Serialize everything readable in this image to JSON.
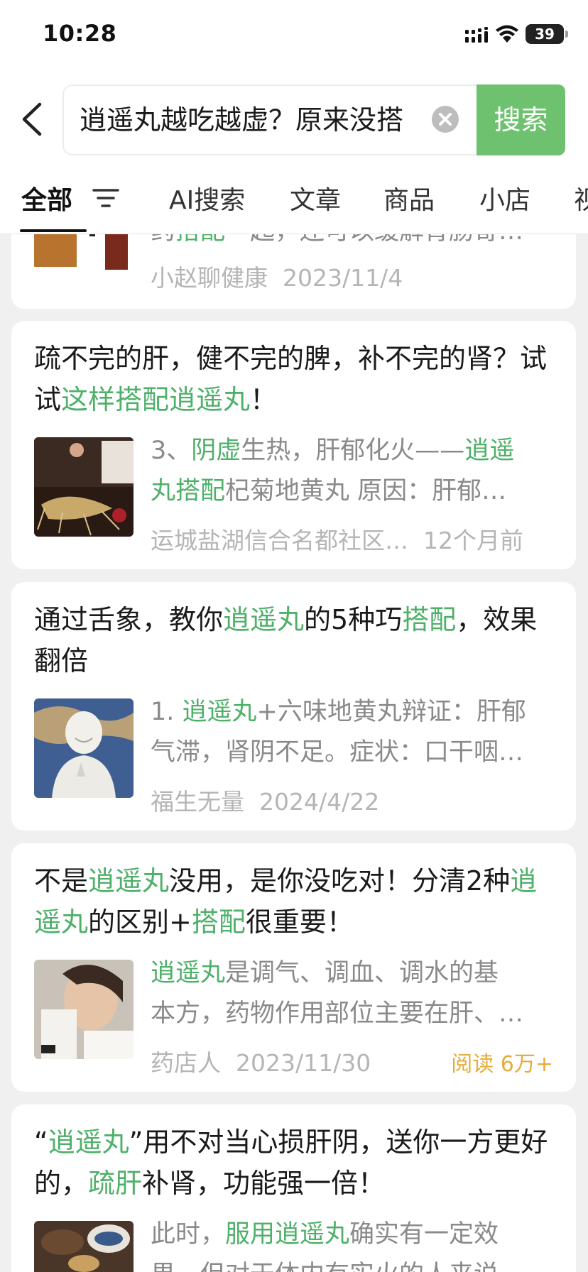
{
  "status": {
    "time": "10:28",
    "battery": "39"
  },
  "search": {
    "query": "逍遥丸越吃越虚？原来没搭",
    "button_label": "搜索"
  },
  "tabs": [
    "全部",
    "AI搜索",
    "文章",
    "商品",
    "小店",
    "视"
  ],
  "cards": [
    {
      "title_parts": [],
      "snippet_lines": [
        [
          {
            "t": "药"
          },
          {
            "t": "搭配",
            "hl": true
          },
          {
            "t": "一起，还可以缓解胃肠寄…"
          }
        ]
      ],
      "source": "小赵聊健康",
      "date": "2023/11/4"
    },
    {
      "title_parts": [
        {
          "t": "疏不完的肝，健不完的脾，补不完的肾？试试"
        },
        {
          "t": "这样搭配逍遥丸",
          "hl": true
        },
        {
          "t": "！"
        }
      ],
      "snippet_lines": [
        [
          {
            "t": "3、"
          },
          {
            "t": "阴虚",
            "hl": true
          },
          {
            "t": "生热，肝郁化火——"
          },
          {
            "t": "逍遥",
            "hl": true
          }
        ],
        [
          {
            "t": "丸搭配",
            "hl": true
          },
          {
            "t": "杞菊地黄丸 原因：肝郁…"
          }
        ]
      ],
      "source": "运城盐湖信合名都社区…",
      "date": "12个月前"
    },
    {
      "title_parts": [
        {
          "t": "通过舌象，教你"
        },
        {
          "t": "逍遥丸",
          "hl": true
        },
        {
          "t": "的5种巧"
        },
        {
          "t": "搭配",
          "hl": true
        },
        {
          "t": "，效果翻倍"
        }
      ],
      "snippet_lines": [
        [
          {
            "t": "1. "
          },
          {
            "t": "逍遥丸",
            "hl": true
          },
          {
            "t": "+六味地黄丸辩证：肝郁"
          }
        ],
        [
          {
            "t": "气滞，肾阴不足。症状：口干咽…"
          }
        ]
      ],
      "source": "福生无量",
      "date": "2024/4/22"
    },
    {
      "title_parts": [
        {
          "t": "不是"
        },
        {
          "t": "逍遥丸",
          "hl": true
        },
        {
          "t": "没用，是你没吃对！分清2种"
        },
        {
          "t": "逍遥丸",
          "hl": true
        },
        {
          "t": "的区别+"
        },
        {
          "t": "搭配",
          "hl": true
        },
        {
          "t": "很重要！"
        }
      ],
      "snippet_lines": [
        [
          {
            "t": "逍遥丸",
            "hl": true
          },
          {
            "t": "是调气、调血、调水的基"
          }
        ],
        [
          {
            "t": "本方，药物作用部位主要在肝、…"
          }
        ]
      ],
      "source": "药店人",
      "date": "2023/11/30",
      "reads": "阅读 6万+"
    },
    {
      "title_parts": [
        {
          "t": "“"
        },
        {
          "t": "逍遥丸",
          "hl": true
        },
        {
          "t": "”用不对当心损肝阴，送你一方更好的，"
        },
        {
          "t": "疏肝",
          "hl": true
        },
        {
          "t": "补肾，功能强一倍！"
        }
      ],
      "snippet_lines": [
        [
          {
            "t": "此时，"
          },
          {
            "t": "服用逍遥丸",
            "hl": true
          },
          {
            "t": "确实有一定效"
          }
        ],
        [
          {
            "t": "果，但对于体内有实火的人来说"
          }
        ]
      ],
      "source": "",
      "date": ""
    }
  ],
  "colors": {
    "accent_green": "#6ec26f",
    "highlight_green": "#4fb06a",
    "reads_orange": "#e6ac3a"
  }
}
